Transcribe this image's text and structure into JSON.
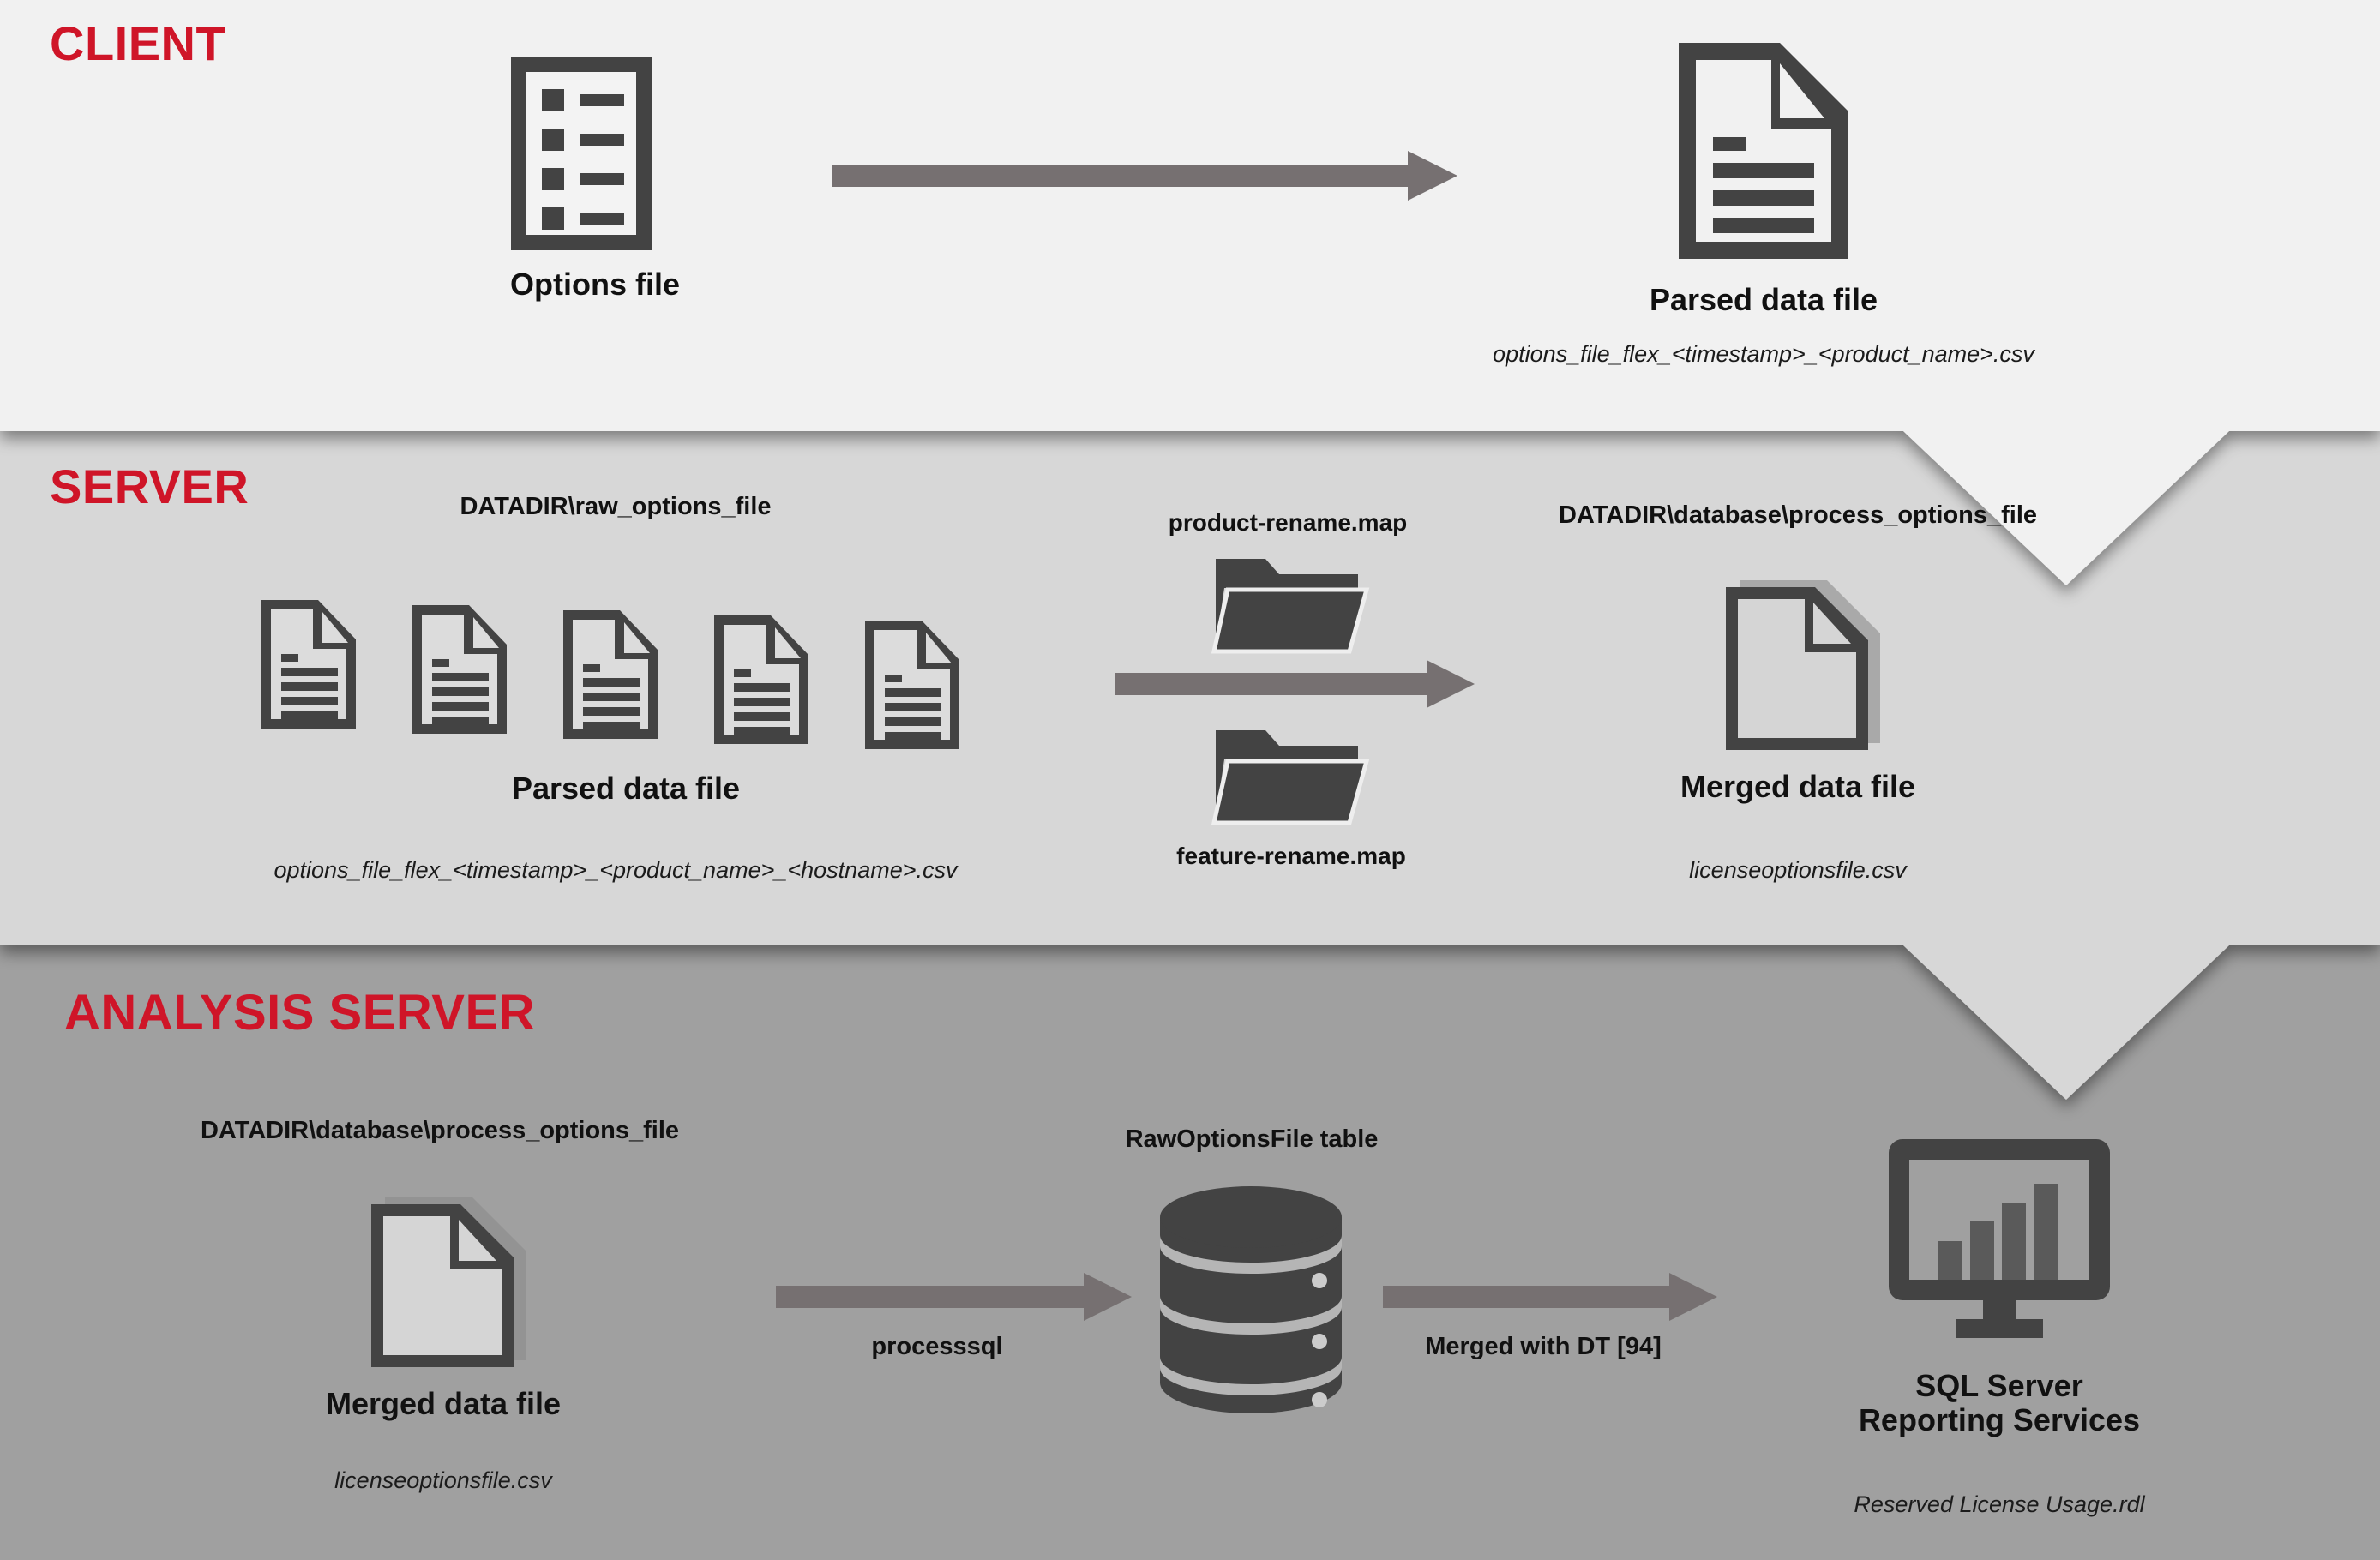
{
  "colors": {
    "accent_red": "#cf1528",
    "client_band": "#f1f1f1",
    "server_band": "#d7d7d7",
    "analysis_band": "#a0a0a0",
    "icon_dark": "#434343",
    "arrow_gray": "#767071"
  },
  "sections": [
    {
      "id": "client",
      "title": "CLIENT",
      "nodes": [
        {
          "name": "Options file",
          "icon": "options-list-file-icon",
          "caption": ""
        },
        {
          "name": "Parsed data file",
          "icon": "document-file-icon",
          "caption": "options_file_flex_<timestamp>_<product_name>.csv"
        }
      ],
      "arrows": [
        {
          "label": ""
        }
      ]
    },
    {
      "id": "server",
      "title": "SERVER",
      "path_labels": [
        "DATADIR\\raw_options_file",
        "DATADIR\\database\\process_options_file"
      ],
      "nodes": [
        {
          "name": "Parsed data file",
          "icon": "multi-document-file-icon",
          "caption": "options_file_flex_<timestamp>_<product_name>_<hostname>.csv"
        },
        {
          "name": "Merged data file",
          "icon": "merged-document-file-icon",
          "caption": "licenseoptionsfile.csv"
        }
      ],
      "maps": [
        {
          "label": "product-rename.map",
          "icon": "folder-icon"
        },
        {
          "label": "feature-rename.map",
          "icon": "folder-icon"
        }
      ],
      "arrows": [
        {
          "label": ""
        }
      ]
    },
    {
      "id": "analysis",
      "title": "ANALYSIS SERVER",
      "path_labels": [
        "DATADIR\\database\\process_options_file",
        "RawOptionsFile table"
      ],
      "nodes": [
        {
          "name": "Merged data file",
          "icon": "merged-document-file-icon",
          "caption": "licenseoptionsfile.csv"
        },
        {
          "name": "",
          "icon": "database-cylinder-icon",
          "caption": ""
        },
        {
          "name": "SQL Server\nReporting Services",
          "name_line1": "SQL Server",
          "name_line2": "Reporting Services",
          "icon": "monitor-chart-icon",
          "caption": "Reserved License Usage.rdl"
        }
      ],
      "arrows": [
        {
          "label": "processsql"
        },
        {
          "label": "Merged with DT [94]"
        }
      ]
    }
  ]
}
